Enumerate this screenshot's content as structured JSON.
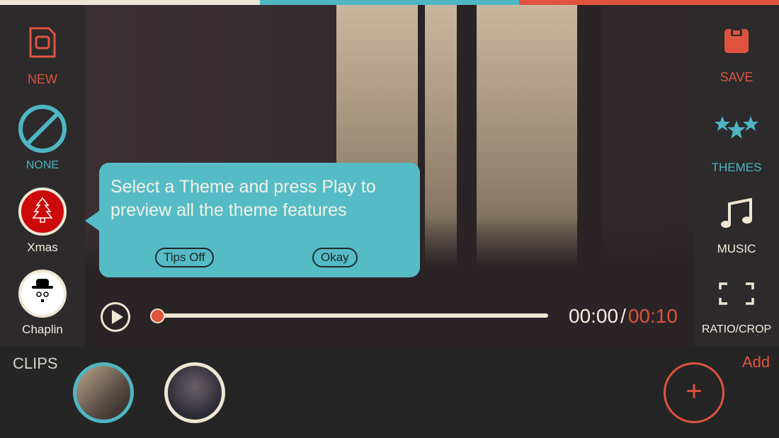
{
  "colors": {
    "accent_red": "#e0533f",
    "accent_teal": "#4fb6c3",
    "cream": "#efe7d2"
  },
  "left_toolbar": [
    {
      "label": "NEW",
      "icon": "new-video-file-icon"
    },
    {
      "label": "NONE",
      "icon": "none-circle-slash-icon"
    },
    {
      "label": "Xmas",
      "icon": "xmas-tree-theme-icon"
    },
    {
      "label": "Chaplin",
      "icon": "chaplin-theme-icon"
    }
  ],
  "right_toolbar": [
    {
      "label": "SAVE",
      "icon": "save-icon"
    },
    {
      "label": "THEMES",
      "icon": "stars-icon"
    },
    {
      "label": "MUSIC",
      "icon": "music-note-icon"
    },
    {
      "label": "RATIO/CROP",
      "icon": "crop-icon"
    }
  ],
  "tooltip": {
    "text": "Select a Theme and press Play to preview all the theme features",
    "tips_off": "Tips Off",
    "okay": "Okay"
  },
  "player": {
    "current_time": "00:00",
    "separator": "/",
    "total_time": "00:10",
    "progress": 0
  },
  "clips": {
    "label": "CLIPS",
    "add_label": "Add",
    "count": 2
  }
}
